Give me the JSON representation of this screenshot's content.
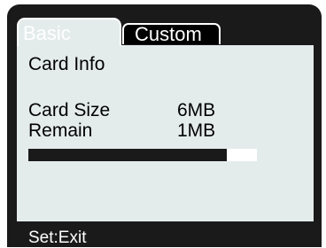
{
  "tabs": [
    {
      "label": "Basic",
      "active": true
    },
    {
      "label": "Custom",
      "active": false
    }
  ],
  "panel": {
    "heading": "Card Info",
    "rows": [
      {
        "label": "Card Size",
        "value": "6MB"
      },
      {
        "label": "Remain",
        "value": "1MB"
      }
    ]
  },
  "usage_bar": {
    "fill_fraction": 0.87
  },
  "footer": {
    "hint": "Set:Exit"
  },
  "colors": {
    "panel_bg": "#e4ebeb",
    "screen_bg": "#1a1a1a",
    "tab_inactive_bg": "#000000",
    "text_light": "#ffffff",
    "text_dark": "#000000"
  }
}
